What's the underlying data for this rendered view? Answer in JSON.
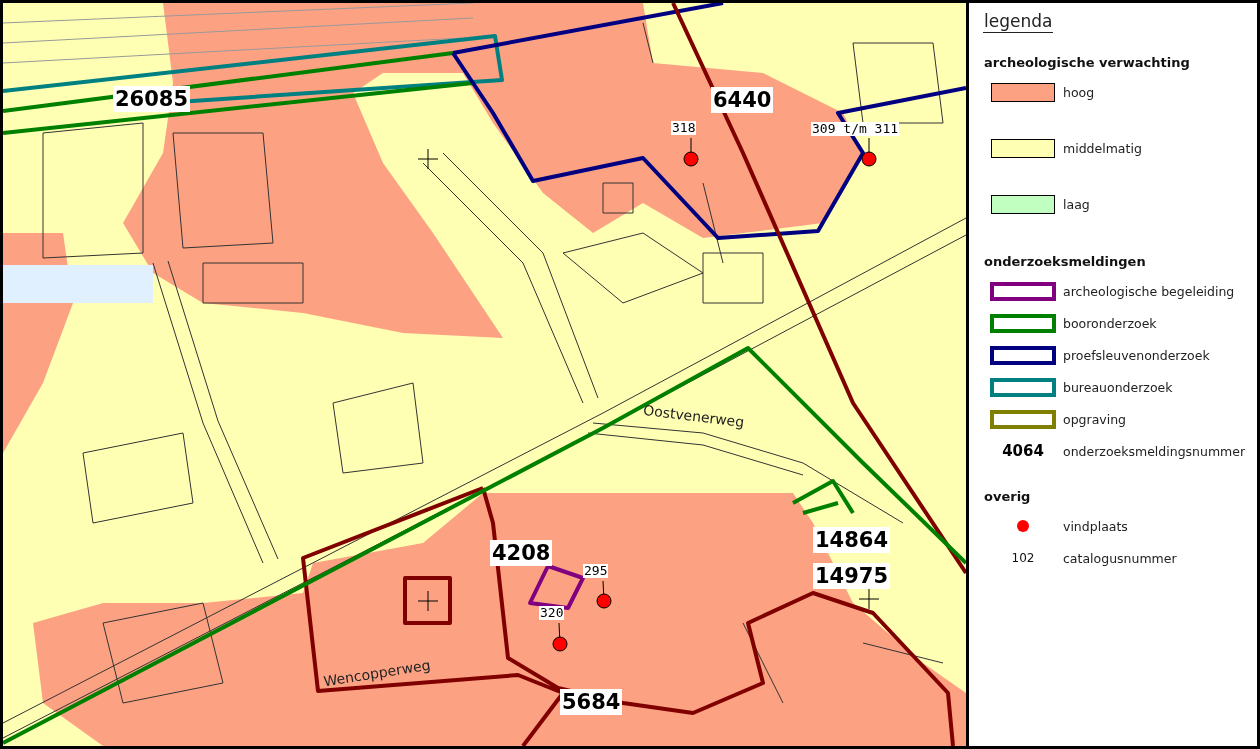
{
  "map": {
    "survey_numbers": [
      "26085",
      "6440",
      "4208",
      "14864",
      "14975",
      "5684"
    ],
    "catalogue_numbers": [
      "318",
      "309 t/m 311",
      "295",
      "320"
    ],
    "street_names": [
      "Oostvenerweg",
      "Wencopperweg"
    ]
  },
  "legend": {
    "title": "legenda",
    "sections": [
      {
        "heading": "archeologische verwachting",
        "items": [
          {
            "kind": "fill",
            "label": "hoog",
            "color": "#fca283"
          },
          {
            "kind": "fill",
            "label": "middelmatig",
            "color": "#ffffb4"
          },
          {
            "kind": "fill",
            "label": "laag",
            "color": "#c0ffc0"
          }
        ]
      },
      {
        "heading": "onderzoeksmeldingen",
        "items": [
          {
            "kind": "outline",
            "label": "archeologische begeleiding",
            "color": "#800080"
          },
          {
            "kind": "outline",
            "label": "booronderzoek",
            "color": "#008000"
          },
          {
            "kind": "outline",
            "label": "proefsleuvenonderzoek",
            "color": "#000080"
          },
          {
            "kind": "outline",
            "label": "bureauonderzoek",
            "color": "#008080"
          },
          {
            "kind": "outline",
            "label": "opgraving",
            "color": "#808000"
          },
          {
            "kind": "number",
            "symbol": "4064",
            "label": "onderzoeksmeldingsnummer"
          }
        ]
      },
      {
        "heading": "overig",
        "items": [
          {
            "kind": "dot",
            "label": "vindplaats",
            "color": "#ff0000"
          },
          {
            "kind": "catalogue",
            "symbol": "102",
            "label": "catalogusnummer"
          }
        ]
      }
    ]
  }
}
